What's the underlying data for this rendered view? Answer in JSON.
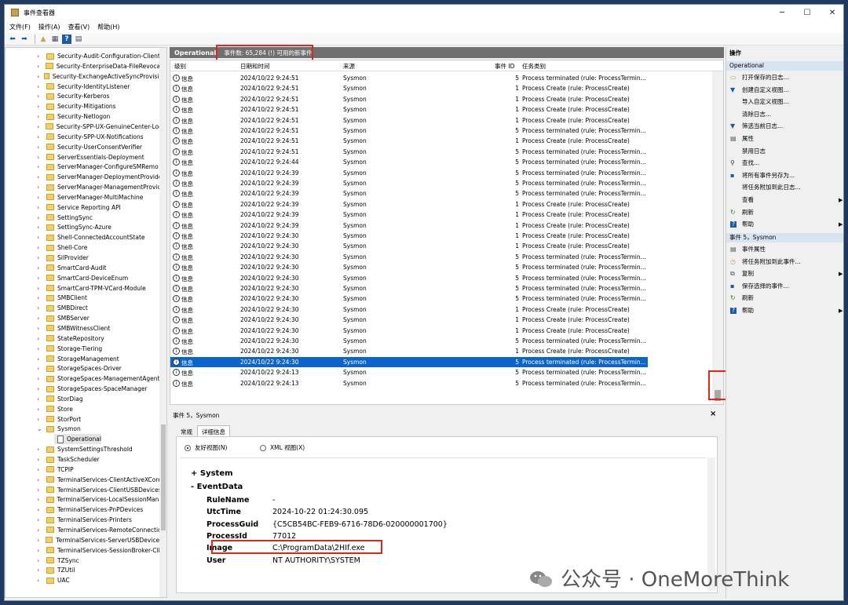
{
  "window": {
    "title": "事件查看器",
    "min": "─",
    "max": "☐",
    "close": "✕"
  },
  "menu": [
    "文件(F)",
    "操作(A)",
    "查看(V)",
    "帮助(H)"
  ],
  "tree": {
    "items": [
      {
        "label": "Security-Audit-Configuration-Client",
        "exp": "›"
      },
      {
        "label": "Security-EnterpriseData-FileRevocat",
        "exp": "›"
      },
      {
        "label": "Security-ExchangeActiveSyncProvisio",
        "exp": "›"
      },
      {
        "label": "Security-IdentityListener",
        "exp": "›"
      },
      {
        "label": "Security-Kerberos",
        "exp": "›"
      },
      {
        "label": "Security-Mitigations",
        "exp": "›"
      },
      {
        "label": "Security-Netlogon",
        "exp": "›"
      },
      {
        "label": "Security-SPP-UX-GenuineCenter-Log",
        "exp": "›"
      },
      {
        "label": "Security-SPP-UX-Notifications",
        "exp": "›"
      },
      {
        "label": "Security-UserConsentVerifier",
        "exp": "›"
      },
      {
        "label": "ServerEssentials-Deployment",
        "exp": "›"
      },
      {
        "label": "ServerManager-ConfigureSMRemo",
        "exp": "›"
      },
      {
        "label": "ServerManager-DeploymentProvide",
        "exp": "›"
      },
      {
        "label": "ServerManager-ManagementProvic",
        "exp": "›"
      },
      {
        "label": "ServerManager-MultiMachine",
        "exp": "›"
      },
      {
        "label": "Service Reporting API",
        "exp": "›"
      },
      {
        "label": "SettingSync",
        "exp": "›"
      },
      {
        "label": "SettingSync-Azure",
        "exp": "›"
      },
      {
        "label": "Shell-ConnectedAccountState",
        "exp": "›"
      },
      {
        "label": "Shell-Core",
        "exp": "›"
      },
      {
        "label": "SilProvider",
        "exp": "›"
      },
      {
        "label": "SmartCard-Audit",
        "exp": "›"
      },
      {
        "label": "SmartCard-DeviceEnum",
        "exp": "›"
      },
      {
        "label": "SmartCard-TPM-VCard-Module",
        "exp": "›"
      },
      {
        "label": "SMBClient",
        "exp": "›"
      },
      {
        "label": "SMBDirect",
        "exp": "›"
      },
      {
        "label": "SMBServer",
        "exp": "›"
      },
      {
        "label": "SMBWitnessClient",
        "exp": "›"
      },
      {
        "label": "StateRepository",
        "exp": "›"
      },
      {
        "label": "Storage-Tiering",
        "exp": "›"
      },
      {
        "label": "StorageManagement",
        "exp": "›"
      },
      {
        "label": "StorageSpaces-Driver",
        "exp": "›"
      },
      {
        "label": "StorageSpaces-ManagementAgent",
        "exp": "›"
      },
      {
        "label": "StorageSpaces-SpaceManager",
        "exp": "›"
      },
      {
        "label": "StorDiag",
        "exp": "›"
      },
      {
        "label": "Store",
        "exp": "›"
      },
      {
        "label": "StorPort",
        "exp": "›"
      },
      {
        "label": "Sysmon",
        "exp": "⌄"
      },
      {
        "label": "Operational",
        "exp": "",
        "child": true
      },
      {
        "label": "SystemSettingsThreshold",
        "exp": "›"
      },
      {
        "label": "TaskScheduler",
        "exp": "›"
      },
      {
        "label": "TCPIP",
        "exp": "›"
      },
      {
        "label": "TerminalServices-ClientActiveXCore",
        "exp": "›"
      },
      {
        "label": "TerminalServices-ClientUSBDevices",
        "exp": "›"
      },
      {
        "label": "TerminalServices-LocalSessionMana",
        "exp": "›"
      },
      {
        "label": "TerminalServices-PnPDevices",
        "exp": "›"
      },
      {
        "label": "TerminalServices-Printers",
        "exp": "›"
      },
      {
        "label": "TerminalServices-RemoteConnectio",
        "exp": "›"
      },
      {
        "label": "TerminalServices-ServerUSBDevices",
        "exp": "›"
      },
      {
        "label": "TerminalServices-SessionBroker-Cli",
        "exp": "›"
      },
      {
        "label": "TZSync",
        "exp": "›"
      },
      {
        "label": "TZUtil",
        "exp": "›"
      },
      {
        "label": "UAC",
        "exp": "›"
      }
    ]
  },
  "log": {
    "name": "Operational",
    "count": "事件数: 65,284 (!) 可用的新事件"
  },
  "columns": [
    "级别",
    "日期和时间",
    "来源",
    "事件 ID",
    "任务类别"
  ],
  "events": [
    {
      "level": "信息",
      "time": "2024/10/22 9:24:51",
      "source": "Sysmon",
      "id": "5",
      "task": "Process terminated (rule: ProcessTermin..."
    },
    {
      "level": "信息",
      "time": "2024/10/22 9:24:51",
      "source": "Sysmon",
      "id": "1",
      "task": "Process Create (rule: ProcessCreate)"
    },
    {
      "level": "信息",
      "time": "2024/10/22 9:24:51",
      "source": "Sysmon",
      "id": "1",
      "task": "Process Create (rule: ProcessCreate)"
    },
    {
      "level": "信息",
      "time": "2024/10/22 9:24:51",
      "source": "Sysmon",
      "id": "1",
      "task": "Process Create (rule: ProcessCreate)"
    },
    {
      "level": "信息",
      "time": "2024/10/22 9:24:51",
      "source": "Sysmon",
      "id": "1",
      "task": "Process Create (rule: ProcessCreate)"
    },
    {
      "level": "信息",
      "time": "2024/10/22 9:24:51",
      "source": "Sysmon",
      "id": "5",
      "task": "Process terminated (rule: ProcessTermin..."
    },
    {
      "level": "信息",
      "time": "2024/10/22 9:24:51",
      "source": "Sysmon",
      "id": "1",
      "task": "Process Create (rule: ProcessCreate)"
    },
    {
      "level": "信息",
      "time": "2024/10/22 9:24:51",
      "source": "Sysmon",
      "id": "5",
      "task": "Process terminated (rule: ProcessTermin..."
    },
    {
      "level": "信息",
      "time": "2024/10/22 9:24:44",
      "source": "Sysmon",
      "id": "5",
      "task": "Process terminated (rule: ProcessTermin..."
    },
    {
      "level": "信息",
      "time": "2024/10/22 9:24:39",
      "source": "Sysmon",
      "id": "5",
      "task": "Process terminated (rule: ProcessTermin..."
    },
    {
      "level": "信息",
      "time": "2024/10/22 9:24:39",
      "source": "Sysmon",
      "id": "5",
      "task": "Process terminated (rule: ProcessTermin..."
    },
    {
      "level": "信息",
      "time": "2024/10/22 9:24:39",
      "source": "Sysmon",
      "id": "5",
      "task": "Process terminated (rule: ProcessTermin..."
    },
    {
      "level": "信息",
      "time": "2024/10/22 9:24:39",
      "source": "Sysmon",
      "id": "1",
      "task": "Process Create (rule: ProcessCreate)"
    },
    {
      "level": "信息",
      "time": "2024/10/22 9:24:39",
      "source": "Sysmon",
      "id": "1",
      "task": "Process Create (rule: ProcessCreate)"
    },
    {
      "level": "信息",
      "time": "2024/10/22 9:24:39",
      "source": "Sysmon",
      "id": "1",
      "task": "Process Create (rule: ProcessCreate)"
    },
    {
      "level": "信息",
      "time": "2024/10/22 9:24:30",
      "source": "Sysmon",
      "id": "1",
      "task": "Process Create (rule: ProcessCreate)"
    },
    {
      "level": "信息",
      "time": "2024/10/22 9:24:30",
      "source": "Sysmon",
      "id": "1",
      "task": "Process Create (rule: ProcessCreate)"
    },
    {
      "level": "信息",
      "time": "2024/10/22 9:24:30",
      "source": "Sysmon",
      "id": "5",
      "task": "Process terminated (rule: ProcessTermin..."
    },
    {
      "level": "信息",
      "time": "2024/10/22 9:24:30",
      "source": "Sysmon",
      "id": "5",
      "task": "Process terminated (rule: ProcessTermin..."
    },
    {
      "level": "信息",
      "time": "2024/10/22 9:24:30",
      "source": "Sysmon",
      "id": "5",
      "task": "Process terminated (rule: ProcessTermin..."
    },
    {
      "level": "信息",
      "time": "2024/10/22 9:24:30",
      "source": "Sysmon",
      "id": "5",
      "task": "Process terminated (rule: ProcessTermin..."
    },
    {
      "level": "信息",
      "time": "2024/10/22 9:24:30",
      "source": "Sysmon",
      "id": "5",
      "task": "Process terminated (rule: ProcessTermin..."
    },
    {
      "level": "信息",
      "time": "2024/10/22 9:24:30",
      "source": "Sysmon",
      "id": "1",
      "task": "Process Create (rule: ProcessCreate)"
    },
    {
      "level": "信息",
      "time": "2024/10/22 9:24:30",
      "source": "Sysmon",
      "id": "1",
      "task": "Process Create (rule: ProcessCreate)"
    },
    {
      "level": "信息",
      "time": "2024/10/22 9:24:30",
      "source": "Sysmon",
      "id": "1",
      "task": "Process Create (rule: ProcessCreate)"
    },
    {
      "level": "信息",
      "time": "2024/10/22 9:24:30",
      "source": "Sysmon",
      "id": "5",
      "task": "Process terminated (rule: ProcessTermin..."
    },
    {
      "level": "信息",
      "time": "2024/10/22 9:24:30",
      "source": "Sysmon",
      "id": "1",
      "task": "Process Create (rule: ProcessCreate)"
    },
    {
      "level": "信息",
      "time": "2024/10/22 9:24:30",
      "source": "Sysmon",
      "id": "5",
      "task": "Process terminated (rule: ProcessTermin...",
      "selected": true
    },
    {
      "level": "信息",
      "time": "2024/10/22 9:24:13",
      "source": "Sysmon",
      "id": "5",
      "task": "Process terminated (rule: ProcessTermin..."
    },
    {
      "level": "信息",
      "time": "2024/10/22 9:24:13",
      "source": "Sysmon",
      "id": "5",
      "task": "Process terminated (rule: ProcessTermin..."
    }
  ],
  "detail": {
    "header": "事件 5，Sysmon",
    "close": "×",
    "tabs": [
      "常规",
      "详细信息"
    ],
    "radio_friendly": "友好视图(N)",
    "radio_xml": "XML 视图(X)",
    "system": "+ System",
    "eventdata": "- EventData",
    "fields": [
      {
        "k": "RuleName",
        "v": "-"
      },
      {
        "k": "UtcTime",
        "v": "2024-10-22 01:24:30.095"
      },
      {
        "k": "ProcessGuid",
        "v": "{C5CB54BC-FEB9-6716-78D6-020000001700}"
      },
      {
        "k": "ProcessId",
        "v": "77012"
      },
      {
        "k": "Image",
        "v": "C:\\ProgramData\\2HIf.exe"
      },
      {
        "k": "User",
        "v": "NT AUTHORITY\\SYSTEM"
      }
    ]
  },
  "actions": {
    "title": "操作",
    "section1": "Operational",
    "items1": [
      {
        "t": "打开保存的日志...",
        "icon": "folder-open-icon"
      },
      {
        "t": "创建自定义视图...",
        "icon": "filter-icon"
      },
      {
        "t": "导入自定义视图...",
        "icon": ""
      },
      {
        "t": "清除日志...",
        "icon": ""
      },
      {
        "t": "筛选当前日志...",
        "icon": "filter-icon"
      },
      {
        "t": "属性",
        "icon": "properties-icon"
      },
      {
        "t": "禁用日志",
        "icon": ""
      },
      {
        "t": "查找...",
        "icon": "find-icon"
      },
      {
        "t": "将所有事件另存为...",
        "icon": "save-icon"
      },
      {
        "t": "将任务附加到此日志...",
        "icon": ""
      },
      {
        "t": "查看",
        "icon": "",
        "arrow": "▶"
      },
      {
        "t": "刷新",
        "icon": "refresh-icon"
      },
      {
        "t": "帮助",
        "icon": "help-icon",
        "arrow": "▶"
      }
    ],
    "section2": "事件 5，Sysmon",
    "items2": [
      {
        "t": "事件属性",
        "icon": "properties-icon"
      },
      {
        "t": "将任务附加到此事件...",
        "icon": "task-icon"
      },
      {
        "t": "复制",
        "icon": "copy-icon",
        "arrow": "▶"
      },
      {
        "t": "保存选择的事件...",
        "icon": "save-icon"
      },
      {
        "t": "刷新",
        "icon": "refresh-icon"
      },
      {
        "t": "帮助",
        "icon": "help-icon",
        "arrow": "▶"
      }
    ]
  },
  "watermark": "公众号 · OneMoreThink",
  "colors": {
    "selection": "#0a64c9",
    "highlight": "#e0251b",
    "header": "#707070"
  }
}
